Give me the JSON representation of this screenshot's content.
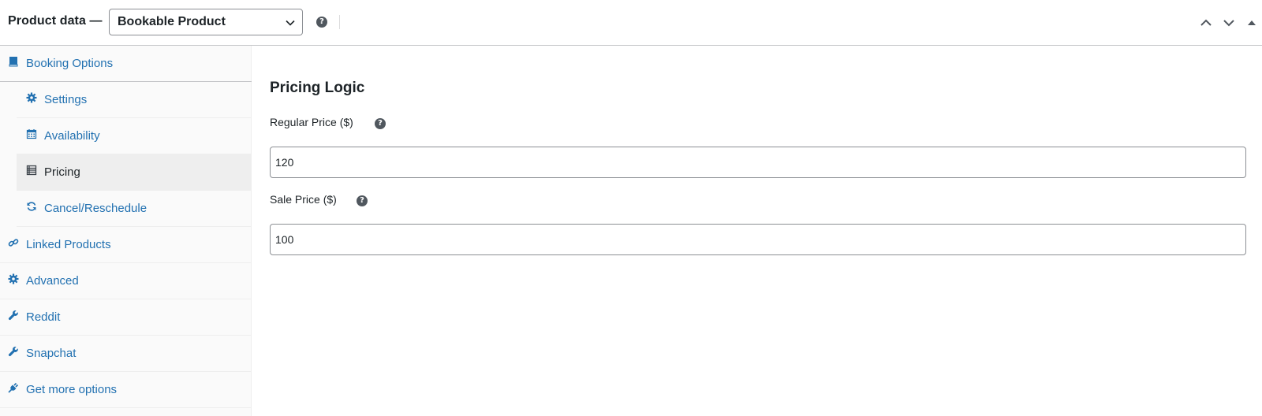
{
  "header": {
    "title": "Product data —",
    "product_type": {
      "selected": "Bookable Product",
      "options": [
        "Bookable Product"
      ]
    }
  },
  "sidebar": {
    "tabs": [
      {
        "key": "booking_options",
        "label": "Booking Options",
        "icon": "book-icon"
      },
      {
        "key": "settings",
        "label": "Settings",
        "icon": "gear-icon",
        "sub": true
      },
      {
        "key": "availability",
        "label": "Availability",
        "icon": "calendar-icon",
        "sub": true
      },
      {
        "key": "pricing",
        "label": "Pricing",
        "icon": "list-icon",
        "sub": true,
        "active": true
      },
      {
        "key": "cancel_reschedule",
        "label": "Cancel/Reschedule",
        "icon": "refresh-icon",
        "sub": true
      },
      {
        "key": "linked_products",
        "label": "Linked Products",
        "icon": "link-icon"
      },
      {
        "key": "advanced",
        "label": "Advanced",
        "icon": "gear-icon"
      },
      {
        "key": "reddit",
        "label": "Reddit",
        "icon": "wrench-icon"
      },
      {
        "key": "snapchat",
        "label": "Snapchat",
        "icon": "wrench-icon"
      },
      {
        "key": "get_more_options",
        "label": "Get more options",
        "icon": "plugin-icon"
      }
    ]
  },
  "main": {
    "section_title": "Pricing Logic",
    "fields": [
      {
        "label": "Regular Price ($)",
        "value": "120"
      },
      {
        "label": "Sale Price ($)",
        "value": "100"
      }
    ]
  },
  "colors": {
    "link": "#2271b1",
    "text": "#1d2327",
    "active_bg": "#eeeeee",
    "sidebar_bg": "#fafafa",
    "border": "#c3c4c7"
  }
}
